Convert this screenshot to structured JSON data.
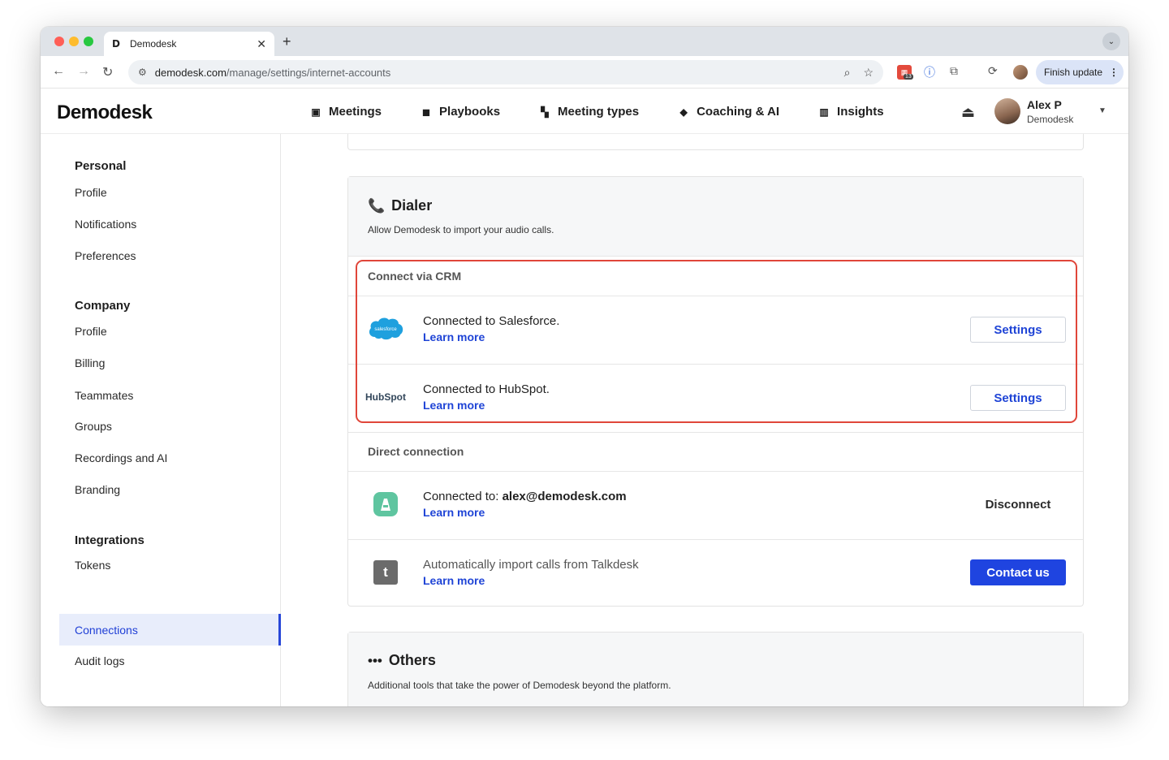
{
  "browser": {
    "tab_title": "Demodesk",
    "tab_favicon": "D",
    "new_tab": "+",
    "url_host": "demodesk.com",
    "url_path": "/manage/settings/internet-accounts",
    "extension_badge": "13",
    "finish_update": "Finish update"
  },
  "app": {
    "logo": "Demodesk",
    "nav": [
      {
        "label": "Meetings",
        "icon": "calendar-icon"
      },
      {
        "label": "Playbooks",
        "icon": "playbook-icon"
      },
      {
        "label": "Meeting types",
        "icon": "grid-icon"
      },
      {
        "label": "Coaching & AI",
        "icon": "graduation-cap-icon"
      },
      {
        "label": "Insights",
        "icon": "chart-icon"
      }
    ],
    "user": {
      "name": "Alex P",
      "org": "Demodesk"
    }
  },
  "sidebar": {
    "sections": [
      {
        "heading": "Personal",
        "items": [
          "Profile",
          "Notifications",
          "Preferences"
        ]
      },
      {
        "heading": "Company",
        "items": [
          "Profile",
          "Billing",
          "Teammates",
          "Groups",
          "Recordings and AI",
          "Branding"
        ]
      },
      {
        "heading": "Integrations",
        "items": [
          "Tokens",
          "Connections",
          "Audit logs"
        ]
      }
    ],
    "active_item": "Connections"
  },
  "dialer": {
    "title": "Dialer",
    "description": "Allow Demodesk to import your audio calls.",
    "crm_section": "Connect via CRM",
    "salesforce": {
      "logo_text": "salesforce",
      "status": "Connected to Salesforce.",
      "learn_more": "Learn more",
      "button": "Settings"
    },
    "hubspot": {
      "logo_text": "HubSpot",
      "status": "Connected to HubSpot.",
      "learn_more": "Learn more",
      "button": "Settings"
    },
    "direct_section": "Direct connection",
    "aircall": {
      "status_prefix": "Connected to: ",
      "email": "alex@demodesk.com",
      "learn_more": "Learn more",
      "button": "Disconnect"
    },
    "talkdesk": {
      "logo_text": "t",
      "status": "Automatically import calls from Talkdesk",
      "learn_more": "Learn more",
      "button": "Contact us"
    }
  },
  "others": {
    "title": "Others",
    "description": "Additional tools that take the power of Demodesk beyond the platform."
  },
  "colors": {
    "accent": "#1f44d6",
    "primary_button": "#1f44e0",
    "highlight": "#e0463a",
    "active_bg": "#e8edfb"
  }
}
